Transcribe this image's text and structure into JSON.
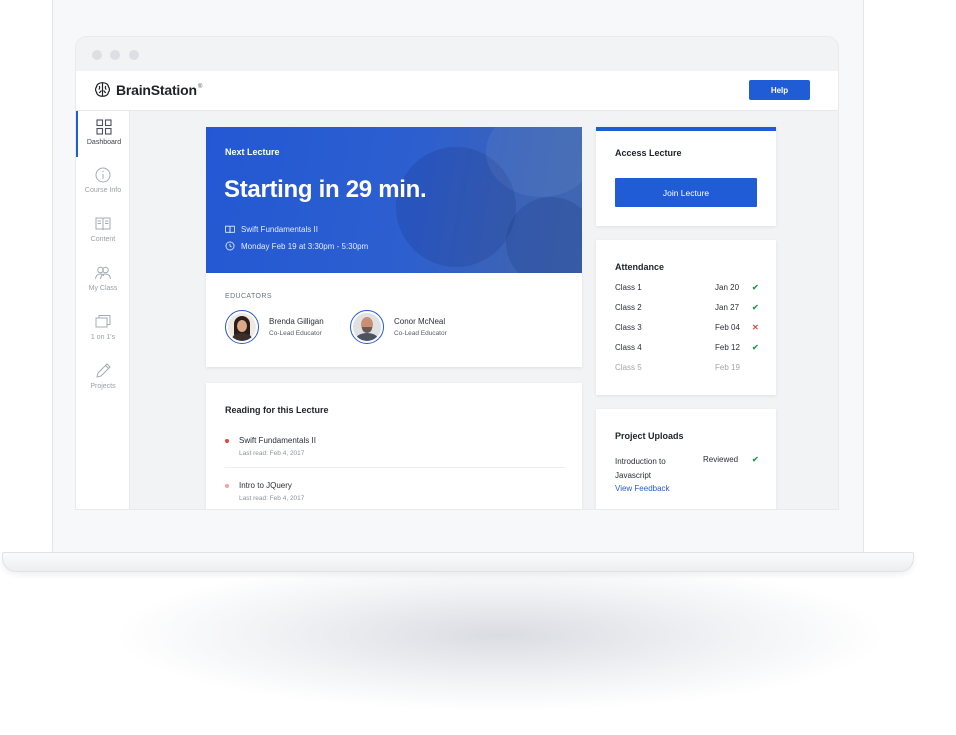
{
  "brand": {
    "name": "BrainStation",
    "trademark": "®"
  },
  "header": {
    "help_label": "Help"
  },
  "sidebar": {
    "items": [
      {
        "label": "Dashboard",
        "icon": "grid-icon",
        "active": true
      },
      {
        "label": "Course Info",
        "icon": "info-icon"
      },
      {
        "label": "Content",
        "icon": "book-icon"
      },
      {
        "label": "My Class",
        "icon": "people-icon"
      },
      {
        "label": "1 on 1's",
        "icon": "chat-icon"
      },
      {
        "label": "Projects",
        "icon": "pencil-icon"
      }
    ]
  },
  "next_lecture": {
    "kicker": "Next Lecture",
    "headline": "Starting in 29 min.",
    "course": "Swift Fundamentals II",
    "schedule": "Monday Feb 19 at 3:30pm - 5:30pm"
  },
  "educators": {
    "label": "EDUCATORS",
    "people": [
      {
        "name": "Brenda Gilligan",
        "role": "Co-Lead Educator"
      },
      {
        "name": "Conor McNeal",
        "role": "Co-Lead Educator"
      }
    ]
  },
  "reading": {
    "title": "Reading for this Lecture",
    "items": [
      {
        "title": "Swift Fundamentals II",
        "subtitle": "Last read: Feb 4, 2017",
        "dot_color": "#e0483c"
      },
      {
        "title": "Intro to JQuery",
        "subtitle": "Last read: Feb 4, 2017",
        "dot_color": "#f3a39a"
      }
    ]
  },
  "access": {
    "title": "Access Lecture",
    "button_label": "Join Lecture"
  },
  "attendance": {
    "title": "Attendance",
    "rows": [
      {
        "label": "Class 1",
        "date": "Jan 20",
        "mark": "✔",
        "status": "present"
      },
      {
        "label": "Class 2",
        "date": "Jan 27",
        "mark": "✔",
        "status": "present"
      },
      {
        "label": "Class 3",
        "date": "Feb 04",
        "mark": "✕",
        "status": "absent"
      },
      {
        "label": "Class 4",
        "date": "Feb 12",
        "mark": "✔",
        "status": "present"
      },
      {
        "label": "Class 5",
        "date": "Feb 19",
        "mark": "",
        "status": "upcoming"
      }
    ]
  },
  "projects": {
    "title": "Project Uploads",
    "name": "Introduction to Javascript",
    "status": "Reviewed",
    "mark": "✔",
    "link_label": "View Feedback"
  },
  "colors": {
    "accent": "#1f5cd6",
    "success": "#1e9b4a",
    "danger": "#e0483c"
  }
}
